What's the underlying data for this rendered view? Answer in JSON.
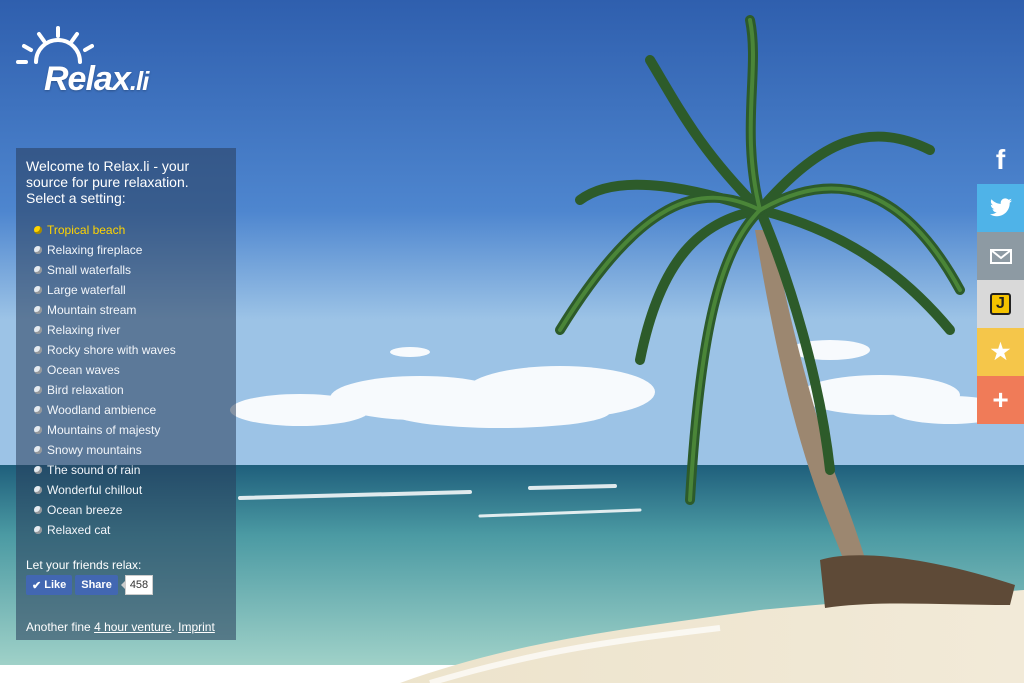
{
  "logo": {
    "name": "Relax",
    "tld": ".li"
  },
  "panel": {
    "welcome": "Welcome to Relax.li - your source for pure relaxation. Select a setting:",
    "settings": [
      "Tropical beach",
      "Relaxing fireplace",
      "Small waterfalls",
      "Large waterfall",
      "Mountain stream",
      "Relaxing river",
      "Rocky shore with waves",
      "Ocean waves",
      "Bird relaxation",
      "Woodland ambience",
      "Mountains of majesty",
      "Snowy mountains",
      "The sound of rain",
      "Wonderful chillout",
      "Ocean breeze",
      "Relaxed cat"
    ],
    "active_setting": "Tropical beach",
    "friends_label": "Let your friends relax:",
    "like_label": "Like",
    "share_label": "Share",
    "share_count": "458",
    "venture_prefix": "Another fine",
    "venture_link": "4 hour venture",
    "venture_dot": ".",
    "imprint_link": "Imprint"
  },
  "share_bar": [
    {
      "icon": "facebook-icon",
      "glyph": "f",
      "color": "#ffffff"
    },
    {
      "icon": "twitter-icon",
      "glyph": "",
      "color": "#4fb3e8"
    },
    {
      "icon": "mail-icon",
      "glyph": "",
      "color": "#8d9aa3"
    },
    {
      "icon": "bookmark-j-icon",
      "glyph": "J",
      "color": "#d9d9d9"
    },
    {
      "icon": "star-icon",
      "glyph": "★",
      "color": "#f5c64a"
    },
    {
      "icon": "plus-icon",
      "glyph": "+",
      "color": "#f07b58"
    }
  ],
  "colors": {
    "active": "#ffd400",
    "panel": "rgba(40,60,90,0.55)"
  }
}
